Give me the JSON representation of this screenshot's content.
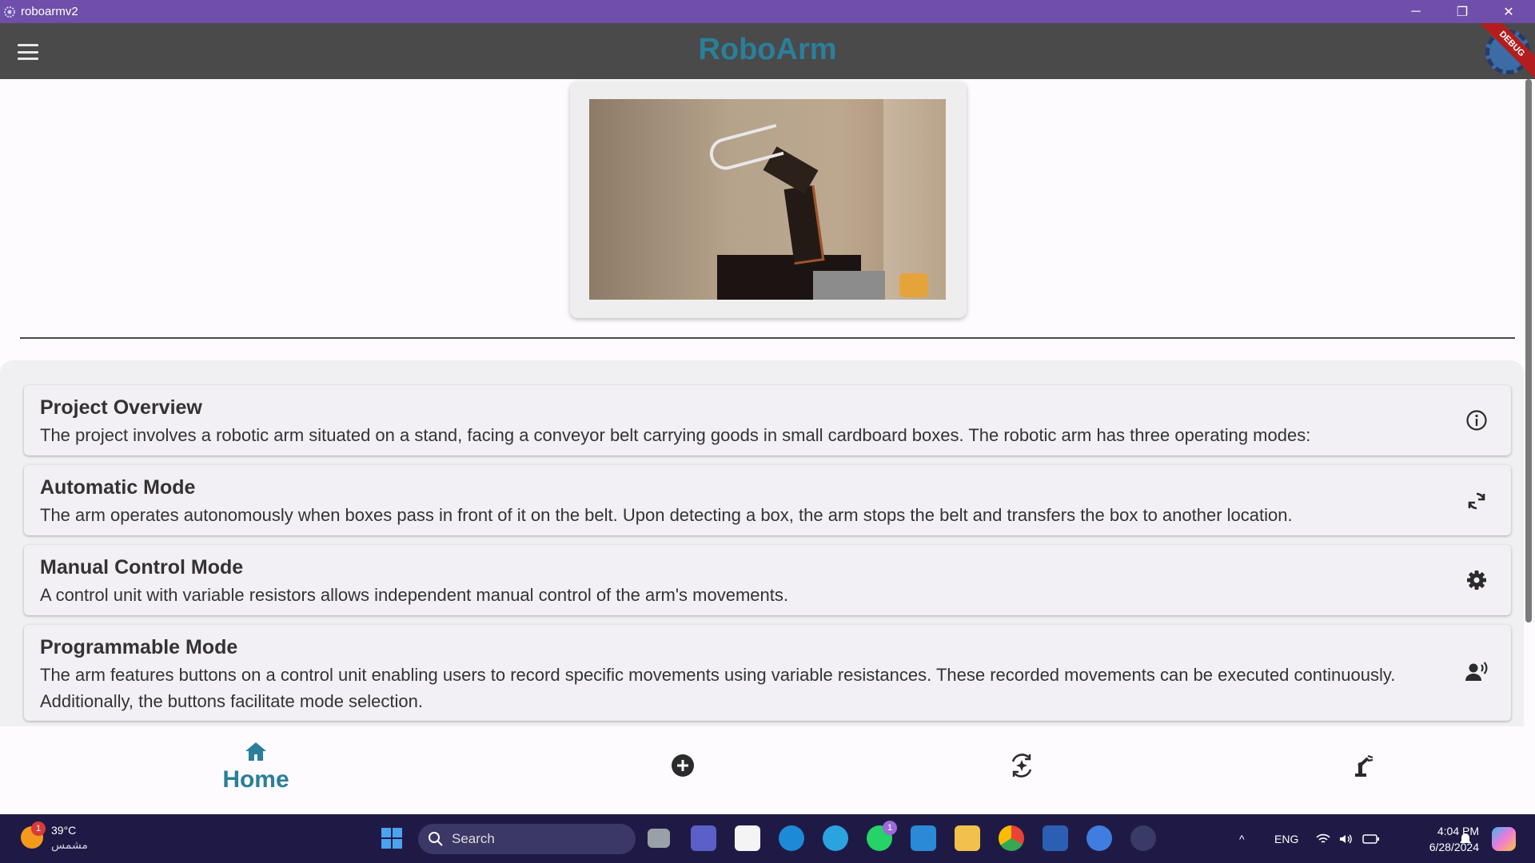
{
  "window": {
    "title": "roboarmv2",
    "controls": {
      "minimize": "─",
      "maximize": "❐",
      "close": "✕"
    }
  },
  "appbar": {
    "title": "RoboArm",
    "debug_label": "DEBUG"
  },
  "cards": [
    {
      "title": "Project Overview",
      "description": "The project involves a robotic arm situated on a stand, facing a conveyor belt carrying goods in small cardboard boxes. The robotic arm has three operating modes:",
      "icon": "info-icon"
    },
    {
      "title": "Automatic Mode",
      "description": "The arm operates autonomously when boxes pass in front of it on the belt. Upon detecting a box, the arm stops the belt and transfers the box to another location.",
      "icon": "sync-icon"
    },
    {
      "title": "Manual Control Mode",
      "description": "A control unit with variable resistors allows independent manual control of the arm's movements.",
      "icon": "gear-icon"
    },
    {
      "title": "Programmable Mode",
      "description": "The arm features buttons on a control unit enabling users to record specific movements using variable resistances. These recorded movements can be executed continuously. Additionally, the buttons facilitate mode selection.",
      "icon": "voice-user-icon"
    }
  ],
  "bottom_nav": {
    "items": [
      {
        "label": "Home",
        "icon": "home-icon",
        "selected": true
      },
      {
        "label": "",
        "icon": "add-circle-icon",
        "selected": false
      },
      {
        "label": "",
        "icon": "motion-icon",
        "selected": false
      },
      {
        "label": "",
        "icon": "robot-arm-icon",
        "selected": false
      }
    ]
  },
  "taskbar": {
    "weather": {
      "temp": "39°C",
      "condition": "مشمس",
      "badge": "1"
    },
    "search_placeholder": "Search",
    "whatsapp_badge": "1",
    "language": "ENG",
    "time": "4:04 PM",
    "date": "6/28/2024"
  },
  "colors": {
    "titlebar": "#6f4fa9",
    "appbar": "#4a4a4a",
    "accent": "#2a7f9a",
    "taskbar": "#1f1a45"
  }
}
